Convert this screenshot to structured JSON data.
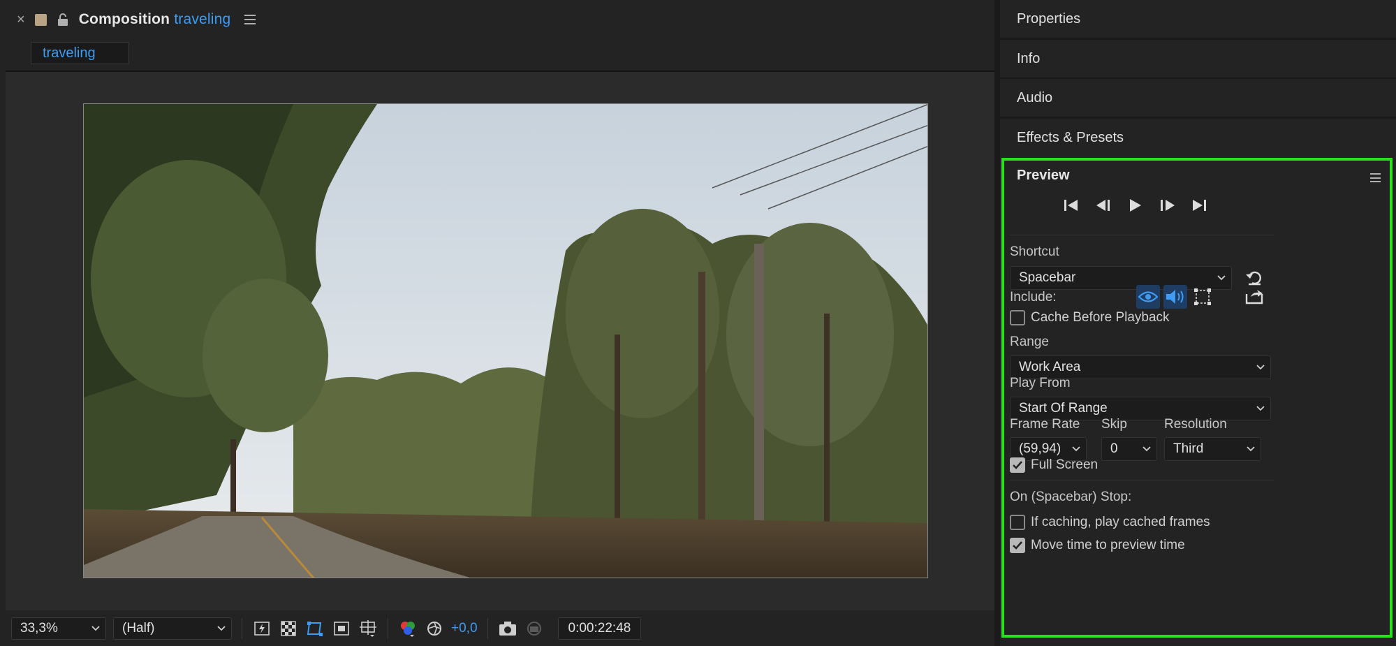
{
  "composition": {
    "title_prefix": "Composition",
    "title_name": "traveling",
    "tab_label": "traveling"
  },
  "viewer_toolbar": {
    "zoom": "33,3%",
    "resolution": "(Half)",
    "exposure": "+0,0",
    "timecode": "0:00:22:48"
  },
  "side_panels": {
    "properties": "Properties",
    "info": "Info",
    "audio": "Audio",
    "effects": "Effects & Presets"
  },
  "preview": {
    "title": "Preview",
    "shortcut_label": "Shortcut",
    "shortcut_value": "Spacebar",
    "include_label": "Include:",
    "cache_before": "Cache Before Playback",
    "range_label": "Range",
    "range_value": "Work Area",
    "play_from_label": "Play From",
    "play_from_value": "Start Of Range",
    "frame_rate_label": "Frame Rate",
    "frame_rate_value": "(59,94)",
    "skip_label": "Skip",
    "skip_value": "0",
    "resolution_label": "Resolution",
    "resolution_value": "Third",
    "full_screen": "Full Screen",
    "stop_label": "On (Spacebar) Stop:",
    "if_caching": "If caching, play cached frames",
    "move_time": "Move time to preview time"
  },
  "colors": {
    "accent": "#3e9cf4",
    "highlight_outline": "#27e21c",
    "label_swatch": "#b9a385"
  }
}
